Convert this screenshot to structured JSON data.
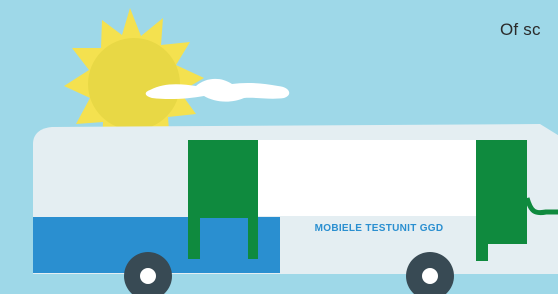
{
  "caption": {
    "text": "Of sc"
  },
  "vehicle": {
    "label": "MOBIELE TESTUNIT GGD"
  },
  "colors": {
    "sky": "#9ed8e8",
    "sun": "#f4e14f",
    "sun_core": "#e8d845",
    "cloud": "#ffffff",
    "bus_body": "#e4eef2",
    "bus_blue": "#2a8fd0",
    "door_green": "#0f8a3e",
    "wheel": "#384a54",
    "label": "#2a8fd0"
  },
  "icons": [
    "sun-icon",
    "cloud-icon",
    "bus-icon",
    "wheel-icon"
  ]
}
